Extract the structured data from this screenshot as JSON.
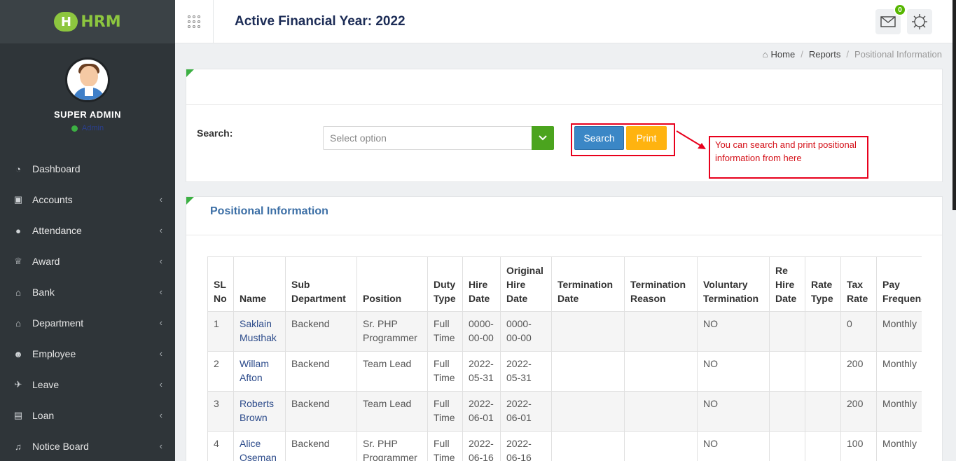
{
  "app": {
    "logo_text": "HRM",
    "logo_letter": "H"
  },
  "header": {
    "title": "Active Financial Year: 2022",
    "mail_badge": "0"
  },
  "sidebar": {
    "profile_name": "SUPER ADMIN",
    "status_text": "Admin",
    "items": [
      {
        "label": "Dashboard",
        "icon": "dashboard-icon",
        "glyph": "◔"
      },
      {
        "label": "Accounts",
        "icon": "briefcase-icon",
        "glyph": "▣"
      },
      {
        "label": "Attendance",
        "icon": "user-icon",
        "glyph": "●"
      },
      {
        "label": "Award",
        "icon": "trophy-icon",
        "glyph": "♕"
      },
      {
        "label": "Bank",
        "icon": "bank-icon",
        "glyph": "⌂"
      },
      {
        "label": "Department",
        "icon": "building-icon",
        "glyph": "⌂"
      },
      {
        "label": "Employee",
        "icon": "users-icon",
        "glyph": "☻"
      },
      {
        "label": "Leave",
        "icon": "plane-icon",
        "glyph": "✈"
      },
      {
        "label": "Loan",
        "icon": "money-icon",
        "glyph": "▤"
      },
      {
        "label": "Notice Board",
        "icon": "bell-icon",
        "glyph": "♫"
      }
    ]
  },
  "breadcrumb": {
    "home": "Home",
    "reports": "Reports",
    "current": "Positional Information"
  },
  "search": {
    "label": "Search:",
    "placeholder": "Select option",
    "search_button": "Search",
    "print_button": "Print",
    "callout": "You can search and print positional information from here"
  },
  "table": {
    "title": "Positional Information",
    "headers": [
      "SL No",
      "Name",
      "Sub Department",
      "Position",
      "Duty Type",
      "Hire Date",
      "Original Hire Date",
      "Termination Date",
      "Termination Reason",
      "Voluntary Termination",
      "Re Hire Date",
      "Rate Type",
      "Tax Rate",
      "Pay Frequency"
    ],
    "rows": [
      [
        "1",
        "Saklain Musthak",
        "Backend",
        "Sr. PHP Programmer",
        "Full Time",
        "0000-00-00",
        "0000-00-00",
        "",
        "",
        "NO",
        "",
        "",
        "0",
        "Monthly"
      ],
      [
        "2",
        "Willam Afton",
        "Backend",
        "Team Lead",
        "Full Time",
        "2022-05-31",
        "2022-05-31",
        "",
        "",
        "NO",
        "",
        "",
        "200",
        "Monthly"
      ],
      [
        "3",
        "Roberts Brown",
        "Backend",
        "Team Lead",
        "Full Time",
        "2022-06-01",
        "2022-06-01",
        "",
        "",
        "NO",
        "",
        "",
        "200",
        "Monthly"
      ],
      [
        "4",
        "Alice Oseman",
        "Backend",
        "Sr. PHP Programmer",
        "Full Time",
        "2022-06-16",
        "2022-06-16",
        "",
        "",
        "NO",
        "",
        "",
        "100",
        "Monthly"
      ]
    ]
  }
}
